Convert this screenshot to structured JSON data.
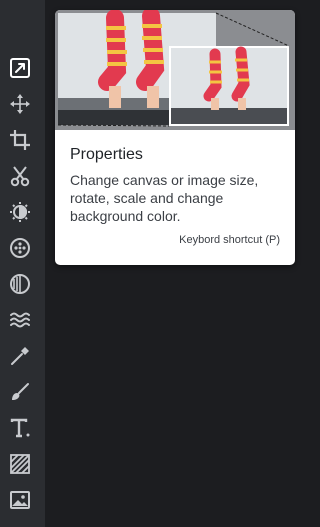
{
  "toolbar": {
    "tools": [
      {
        "name": "properties-icon",
        "active": true
      },
      {
        "name": "move-icon"
      },
      {
        "name": "crop-icon"
      },
      {
        "name": "cut-icon"
      },
      {
        "name": "adjust-icon"
      },
      {
        "name": "filter-icon"
      },
      {
        "name": "vignette-icon"
      },
      {
        "name": "distort-icon"
      },
      {
        "name": "retouch-icon"
      },
      {
        "name": "brush-icon"
      },
      {
        "name": "text-icon"
      },
      {
        "name": "texture-icon"
      },
      {
        "name": "image-icon"
      }
    ]
  },
  "colors": {
    "toolbar_bg": "#2b2d31",
    "workspace_bg": "#1c1d20",
    "icon": "#c8cace",
    "sock_red": "#e23a4f",
    "sock_yellow": "#f4c542",
    "sock_pink": "#e86aa8"
  },
  "tooltip": {
    "title": "Properties",
    "description": "Change canvas or image size, rotate, scale and change background color.",
    "shortcut": "Keybord shortcut (P)"
  }
}
